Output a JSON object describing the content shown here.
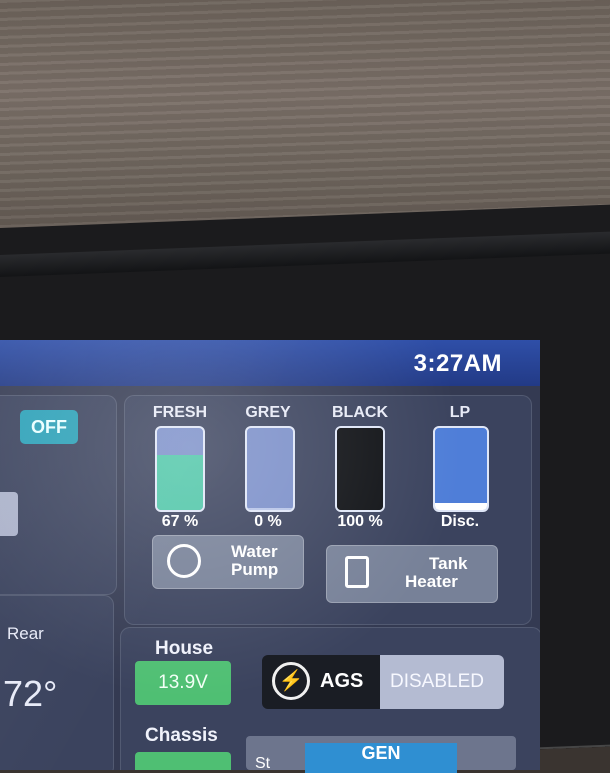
{
  "status": {
    "time": "3:27AM"
  },
  "left_column": {
    "off_button": "OFF",
    "rear_label": "Rear",
    "rear_temp": "72°"
  },
  "tanks": [
    {
      "label": "FRESH",
      "percent": "67 %",
      "level": 0.67,
      "color": "#4fc6a8"
    },
    {
      "label": "GREY",
      "percent": "0 %",
      "level": 0.02,
      "color": "#b7c4e8"
    },
    {
      "label": "BLACK",
      "percent": "100 %",
      "level": 1.0,
      "color": "#101216"
    },
    {
      "label": "LP",
      "percent": "Disc.",
      "level": 0.04,
      "color": "#ffffff"
    }
  ],
  "controls": {
    "water_pump": {
      "line1": "Water",
      "line2": "Pump"
    },
    "tank_heater": {
      "line1": "Tank",
      "line2": "Heater"
    }
  },
  "power": {
    "house_label": "House",
    "house_voltage": "13.9V",
    "chassis_label": "Chassis"
  },
  "ags": {
    "label": "AGS",
    "state": "DISABLED"
  },
  "generator": {
    "label": "GEN",
    "partial_text": "St"
  }
}
